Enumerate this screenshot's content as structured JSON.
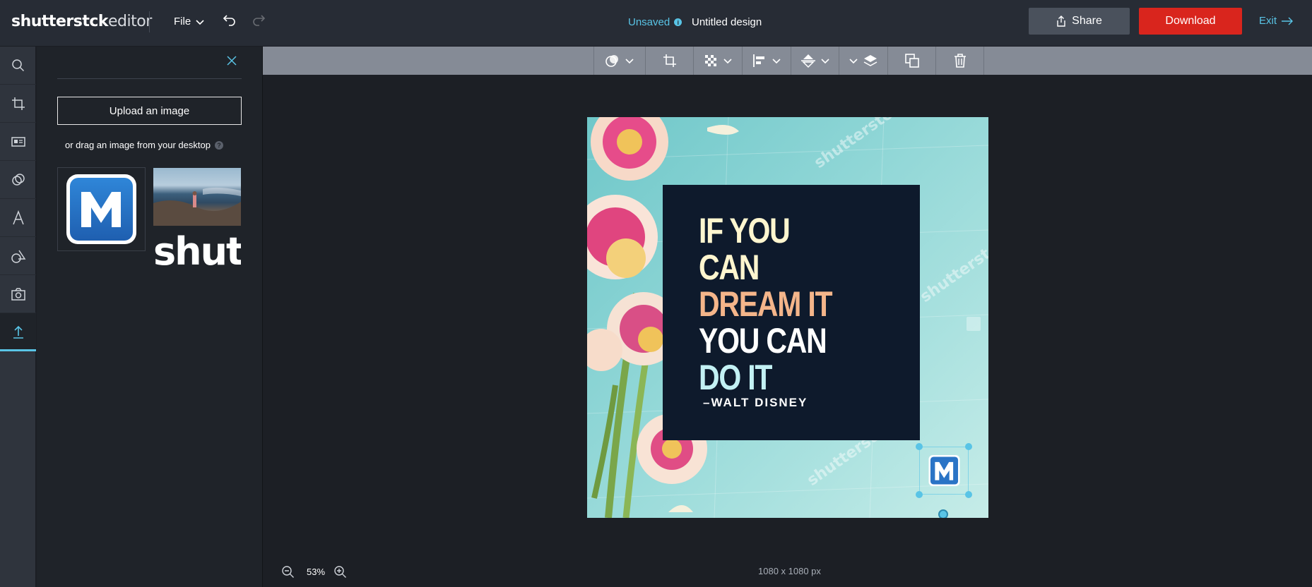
{
  "app": {
    "logo_bold": "shutterst",
    "logo_mid": "ck",
    "logo_light": "editor",
    "file_menu": "File",
    "status": "Unsaved",
    "design_title": "Untitled design",
    "share_label": "Share",
    "download_label": "Download",
    "exit_label": "Exit"
  },
  "rail": {
    "items": [
      "search-icon",
      "crop-icon",
      "template-icon",
      "filter-icon",
      "text-icon",
      "shapes-icon",
      "camera-icon",
      "upload-icon"
    ],
    "active": "upload-icon"
  },
  "panel": {
    "upload_label": "Upload an image",
    "drag_hint": "or drag an image from your desktop",
    "thumb_text": "shutt"
  },
  "canvas": {
    "quote_lines": [
      "IF YOU",
      "CAN",
      "DREAM IT",
      "YOU CAN",
      "DO IT"
    ],
    "quote_colors": [
      "#fff6cf",
      "#fff6cf",
      "#f4b58a",
      "#ffffff",
      "#c3f1f4"
    ],
    "author": "–WALT DISNEY",
    "watermark": "shutterstock",
    "size_label": "1080 x 1080 px"
  },
  "footer": {
    "zoom": "53%"
  },
  "colors": {
    "accent": "#59c4e6",
    "download": "#d9251d",
    "topbar": "#272c35"
  }
}
